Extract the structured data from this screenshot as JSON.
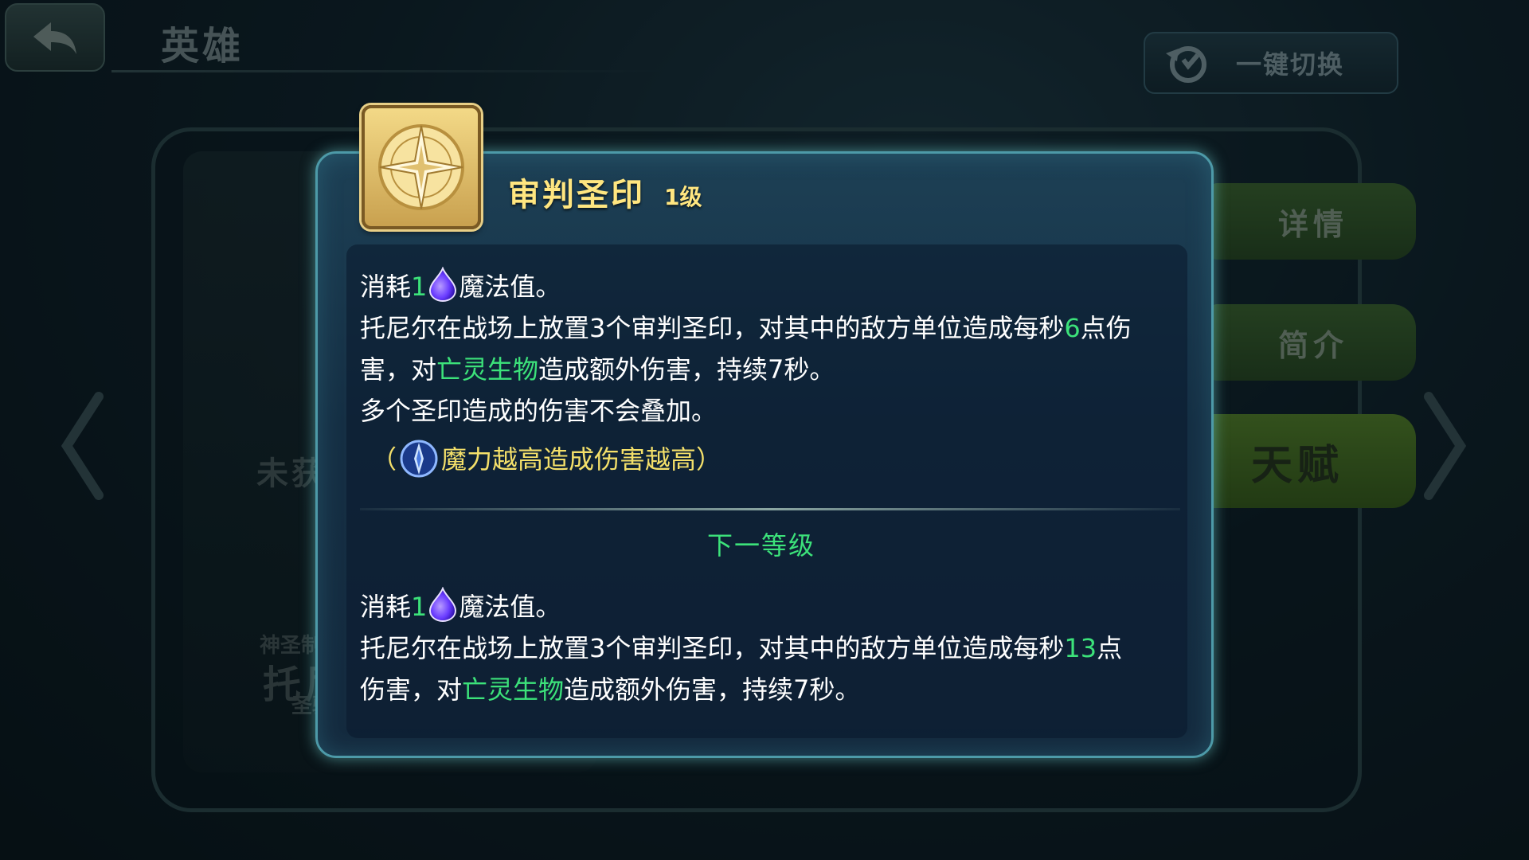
{
  "header": {
    "title": "英雄",
    "switch_label": "一键切换"
  },
  "hero": {
    "status": "未获得",
    "subtitle": "神圣制裁者",
    "name": "托尼尔",
    "class": "圣骑"
  },
  "side_tabs": {
    "detail": "详情",
    "intro": "简介",
    "talent": "天赋"
  },
  "popup": {
    "rune_name": "审判圣印",
    "rune_level": "1级",
    "current": {
      "cost_prefix": "消耗",
      "cost_value": "1",
      "cost_suffix": "魔法值。",
      "line2_a": "托尼尔在战场上放置3个审判圣印，对其中的敌方单位造成每秒",
      "line2_dmg": "6",
      "line2_b": "点伤",
      "line3_a": "害，对",
      "line3_undead": "亡灵生物",
      "line3_b": "造成额外伤害，持续7秒。",
      "line4": "多个圣印造成的伤害不会叠加。"
    },
    "magic_note_open": "（",
    "magic_note_text": "魔力越高造成伤害越高",
    "magic_note_close": "）",
    "next_level_label": "下一等级",
    "next": {
      "cost_prefix": "消耗",
      "cost_value": "1",
      "cost_suffix": "魔法值。",
      "line2_a": "托尼尔在战场上放置3个审判圣印，对其中的敌方单位造成每秒",
      "line2_dmg": "13",
      "line2_b": "点",
      "line3_a": "伤害，对",
      "line3_undead": "亡灵生物",
      "line3_b": "造成额外伤害，持续7秒。"
    }
  },
  "colors": {
    "highlight_green": "#3ce27a",
    "title_gold": "#ffe680",
    "note_yellow": "#f4e06a",
    "mana_purple": "#6a3cff"
  },
  "icons": {
    "back": "back-arrow-icon",
    "switch": "swap-cycle-icon",
    "rune": "compass-star-icon",
    "mana": "mana-drop-icon",
    "magic": "magic-power-icon"
  }
}
